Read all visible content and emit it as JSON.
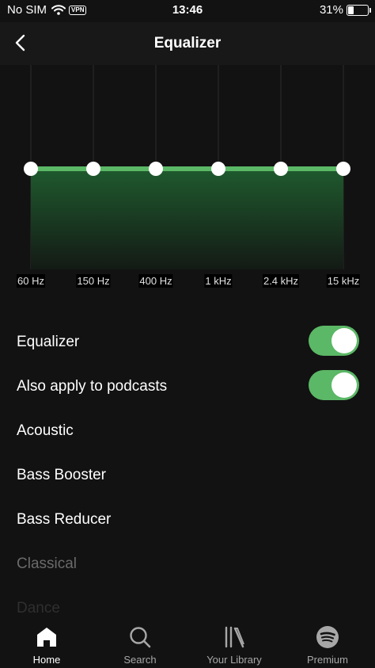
{
  "status_bar": {
    "carrier": "No SIM",
    "vpn": "VPN",
    "time": "13:46",
    "battery_text": "31%",
    "battery_level": 0.31
  },
  "header": {
    "title": "Equalizer",
    "back_icon": "chevron-left-icon"
  },
  "equalizer": {
    "bands": [
      "60 Hz",
      "150 Hz",
      "400 Hz",
      "1 kHz",
      "2.4 kHz",
      "15 kHz"
    ],
    "gains": [
      0,
      0,
      0,
      0,
      0,
      0
    ],
    "accent_color": "#5bb866"
  },
  "settings": {
    "equalizer_label": "Equalizer",
    "equalizer_enabled": true,
    "podcasts_label": "Also apply to podcasts",
    "podcasts_enabled": true,
    "toggle_color": "#5bb866"
  },
  "presets": [
    "Acoustic",
    "Bass Booster",
    "Bass Reducer",
    "Classical",
    "Dance"
  ],
  "nav": {
    "items": [
      {
        "label": "Home",
        "icon": "home-icon",
        "active": true
      },
      {
        "label": "Search",
        "icon": "search-icon",
        "active": false
      },
      {
        "label": "Your Library",
        "icon": "library-icon",
        "active": false
      },
      {
        "label": "Premium",
        "icon": "spotify-icon",
        "active": false
      }
    ]
  }
}
